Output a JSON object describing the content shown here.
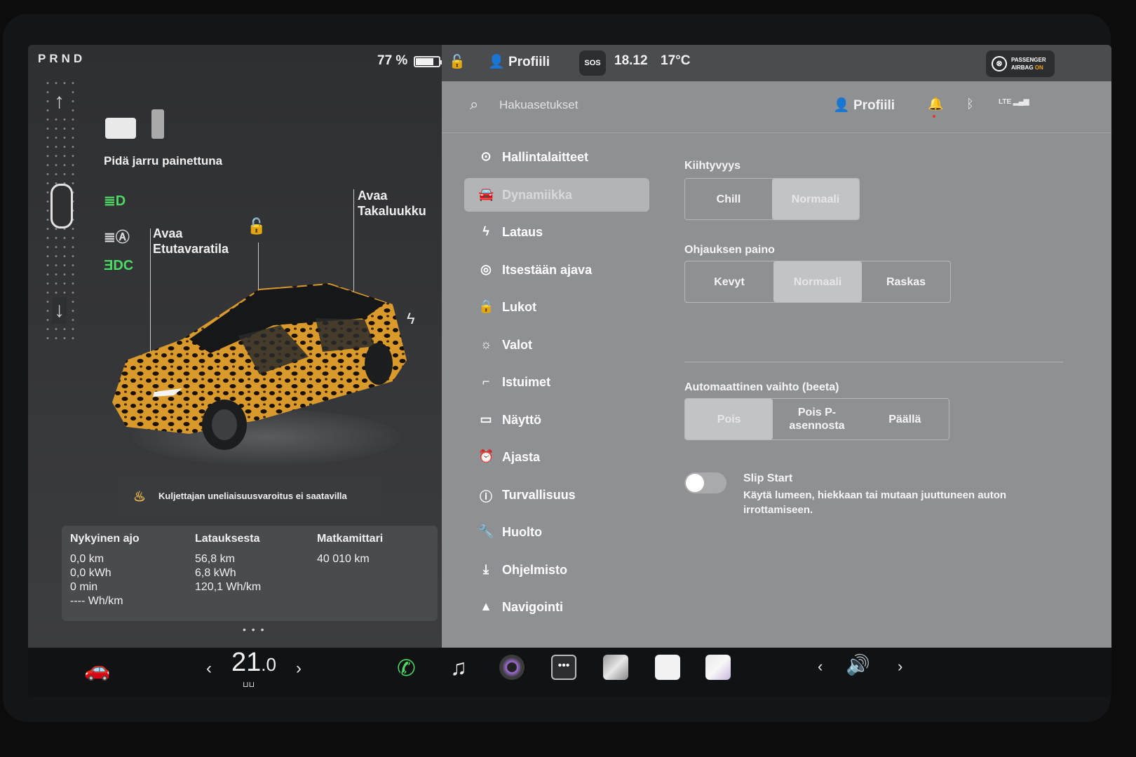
{
  "status": {
    "gears": "PRND",
    "battery_pct": "77 %",
    "battery_fraction": 0.77,
    "profile": "Profiili",
    "sos": "SOS",
    "time": "18.12",
    "outside_temp": "17°C",
    "airbag_line1": "PASSENGER",
    "airbag_line2": "AIRBAG",
    "airbag_state": "ON"
  },
  "vehicle": {
    "brake_hint": "Pidä jarru painettuna",
    "open_frunk_1": "Avaa",
    "open_frunk_2": "Etutavaratila",
    "open_trunk_1": "Avaa",
    "open_trunk_2": "Takaluukku",
    "drowsiness_warning": "Kuljettajan uneliaisuusvaroitus ei saatavilla"
  },
  "trip": {
    "current": {
      "title": "Nykyinen ajo",
      "lines": [
        "0,0 km",
        "0,0 kWh",
        "0 min",
        "---- Wh/km"
      ]
    },
    "since_charge": {
      "title": "Latauksesta",
      "lines": [
        "56,8 km",
        "6,8 kWh",
        "120,1 Wh/km"
      ]
    },
    "odometer": {
      "title": "Matkamittari",
      "lines": [
        "40 010 km"
      ]
    },
    "page_dots": "• • •"
  },
  "search": {
    "placeholder": "Hakuasetukset",
    "profile": "Profiili"
  },
  "menu": [
    {
      "label": "Hallintalaitteet",
      "icon": "toggle-icon",
      "glyph": "⊙"
    },
    {
      "label": "Dynamiikka",
      "icon": "car-icon",
      "glyph": "🚘",
      "active": true
    },
    {
      "label": "Lataus",
      "icon": "bolt-icon",
      "glyph": "ϟ"
    },
    {
      "label": "Itsestään ajava",
      "icon": "steering-wheel-icon",
      "glyph": "◎"
    },
    {
      "label": "Lukot",
      "icon": "lock-icon",
      "glyph": "🔒"
    },
    {
      "label": "Valot",
      "icon": "sun-icon",
      "glyph": "☼"
    },
    {
      "label": "Istuimet",
      "icon": "seat-icon",
      "glyph": "⌐"
    },
    {
      "label": "Näyttö",
      "icon": "display-icon",
      "glyph": "▭"
    },
    {
      "label": "Ajasta",
      "icon": "alarm-icon",
      "glyph": "⏰"
    },
    {
      "label": "Turvallisuus",
      "icon": "info-circle-icon",
      "glyph": "ⓘ"
    },
    {
      "label": "Huolto",
      "icon": "wrench-icon",
      "glyph": "🔧"
    },
    {
      "label": "Ohjelmisto",
      "icon": "download-icon",
      "glyph": "⤓"
    },
    {
      "label": "Navigointi",
      "icon": "navigation-icon",
      "glyph": "▲"
    }
  ],
  "dynamics": {
    "acceleration": {
      "title": "Kiihtyvyys",
      "options": [
        "Chill",
        "Normaali"
      ],
      "selected": "Normaali"
    },
    "steering": {
      "title": "Ohjauksen paino",
      "options": [
        "Kevyt",
        "Normaali",
        "Raskas"
      ],
      "selected": "Normaali"
    },
    "auto_shift": {
      "title": "Automaattinen vaihto (beeta)",
      "options": [
        "Pois",
        "Pois P-\nasennosta",
        "Päällä"
      ],
      "selected": "Pois"
    },
    "slip_start": {
      "title": "Slip Start",
      "description": "Käytä lumeen, hiekkaan tai mutaan juuttuneen auton irrottamiseen.",
      "enabled": false
    }
  },
  "dock": {
    "cabin_temp": "21",
    "cabin_temp_decimal": ".0",
    "left_chevron": "‹",
    "right_chevron": "›",
    "apps": [
      "phone-icon",
      "music-icon",
      "camera-icon",
      "more-icon",
      "app-tile-1",
      "app-tile-2",
      "app-tile-3"
    ]
  },
  "colors": {
    "accent_green": "#4cd964",
    "airbag_on": "#f0a020",
    "active_menu": "#b3b4b6"
  }
}
